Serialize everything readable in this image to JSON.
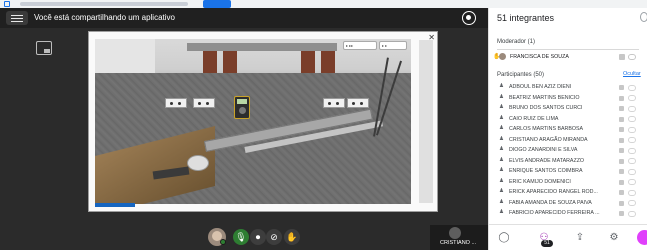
{
  "top_banner": {},
  "share_bar": {
    "text": "Você está compartilhando um aplicativo"
  },
  "sidebar": {
    "title": "51 integrantes",
    "moderator_section": "Moderador (1)",
    "moderator": "FRANCISCA DE SOUZA",
    "participants_section": "Participantes (50)",
    "participants_link": "Ocultar",
    "participants": [
      "ADBOUL BEN AZIZ DIENI",
      "BEATRIZ MARTINS BENICIO",
      "BRUNO DOS SANTOS CURCI",
      "CAIO RUIZ DE LIMA",
      "CARLOS MARTINS BARBOSA",
      "CRISTIANO ARAGÃO MIRANDA",
      "DIOGO ZANARDINI E SILVA",
      "ELVIS ANDRADE MATARAZZO",
      "ENRIQUE SANTOS COIMBRA",
      "ERIC KAMIJO DOMENICI",
      "ERICK APARECIDO RANGEL ROD...",
      "FABIA AMANDA DE SOUZA PAIVA",
      "FABRICIO APARECIDO FERREIRA ..."
    ],
    "footer_badge": "51"
  },
  "camera_tile": {
    "name": "CRISTIANO ..."
  },
  "colors": {
    "accent": "#1a73e8",
    "mic_active": "#2e7d32",
    "fab": "#e040fb"
  }
}
